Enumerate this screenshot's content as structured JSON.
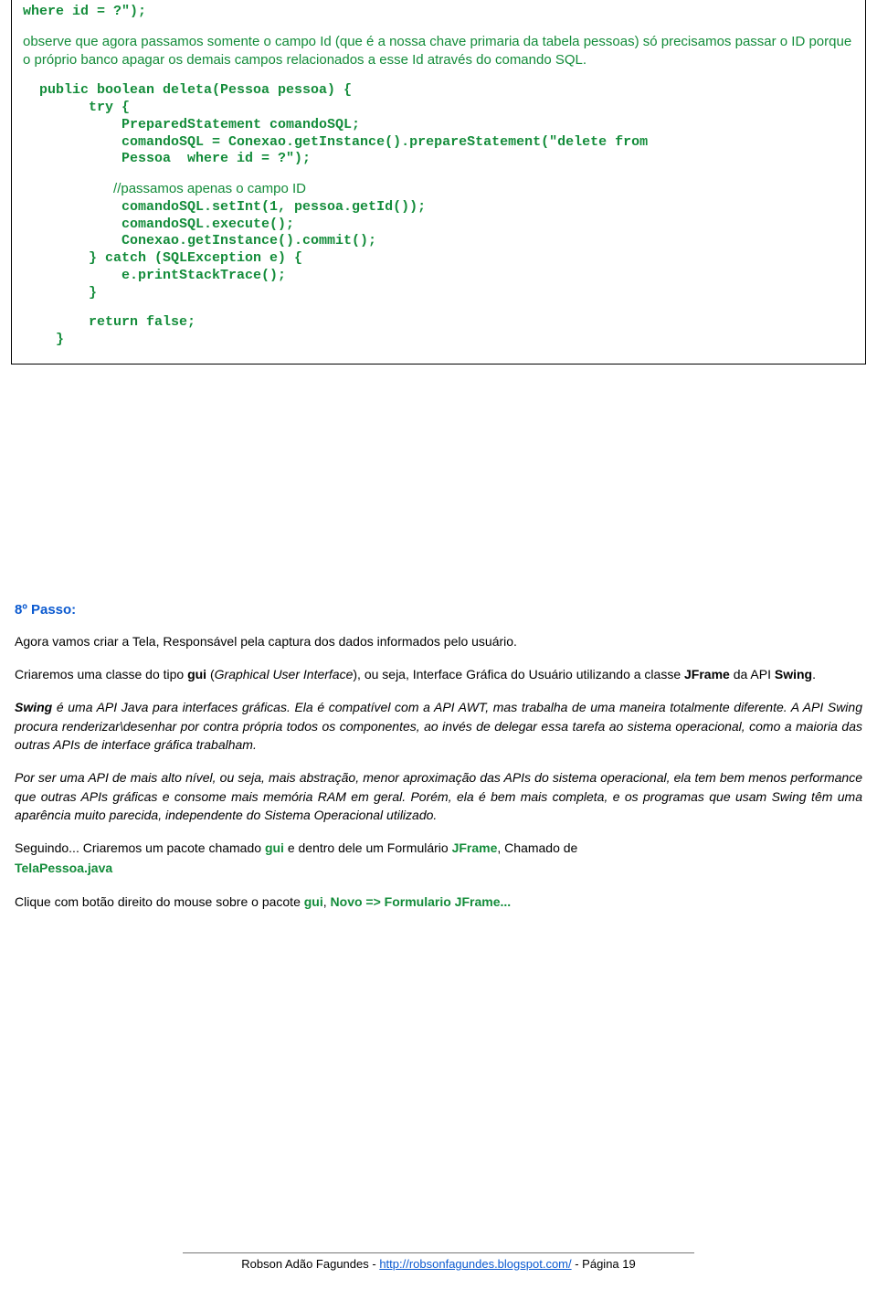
{
  "code": {
    "l1": "where id = ?\");",
    "l2": "observe que agora passamos somente o campo Id (que é a nossa chave primaria da tabela pessoas) só precisamos passar o ID porque  o próprio banco apagar os demais campos relacionados  a esse Id através do comando SQL.",
    "l3": "  public boolean deleta(Pessoa pessoa) {",
    "l4": "        try {",
    "l5": "            PreparedStatement comandoSQL;",
    "l6": "            comandoSQL = Conexao.getInstance().prepareStatement(\"delete from",
    "l7": "            Pessoa  where id = ?\");",
    "c1": "//passamos apenas o campo ID",
    "l8": "            comandoSQL.setInt(1, pessoa.getId());",
    "l9": "            comandoSQL.execute();",
    "l10": "            Conexao.getInstance().commit();",
    "l11": "        } catch (SQLException e) {",
    "l12": "            e.printStackTrace();",
    "l13": "        }",
    "l14": "        return false;",
    "l15": "    }"
  },
  "body": {
    "step": "8º Passo:",
    "p1": "Agora vamos criar a Tela, Responsável pela captura dos dados informados pelo usuário.",
    "p2a": "Criaremos uma classe do tipo ",
    "p2b": "gui",
    "p2c": " (",
    "p2d": "Graphical User Interface",
    "p2e": "), ou seja, Interface Gráfica do Usuário utilizando a classe ",
    "p2f": "JFrame",
    "p2g": " da API ",
    "p2h": "Swing",
    "p2i": ".",
    "p3a": "Swing",
    "p3b": " é uma API Java para interfaces gráficas. Ela é compatível com a API AWT, mas trabalha de uma maneira totalmente diferente. A API Swing procura renderizar\\desenhar por contra própria todos os componentes, ao invés de delegar essa tarefa ao sistema operacional, como a maioria das outras APIs de interface gráfica trabalham.",
    "p4": "Por ser uma API de mais alto nível, ou seja, mais abstração, menor aproximação das APIs do sistema operacional, ela tem bem menos performance que outras APIs gráficas e consome mais memória RAM em geral. Porém, ela é bem mais completa, e os programas que usam Swing têm uma aparência muito parecida, independente do Sistema Operacional utilizado.",
    "p5a": "Seguindo... Criaremos um pacote chamado ",
    "p5b": "gui",
    "p5c": " e dentro dele um Formulário ",
    "p5d": "JFrame",
    "p5e": ", Chamado de ",
    "p5f": "TelaPessoa.java",
    "p6a": "Clique com botão direito do mouse sobre o pacote ",
    "p6b": "gui",
    "p6c": ", ",
    "p6d": "Novo => Formulario JFrame..."
  },
  "footer": {
    "author": "Robson Adão Fagundes - ",
    "link": "http://robsonfagundes.blogspot.com/",
    "page": " - Página 19"
  }
}
